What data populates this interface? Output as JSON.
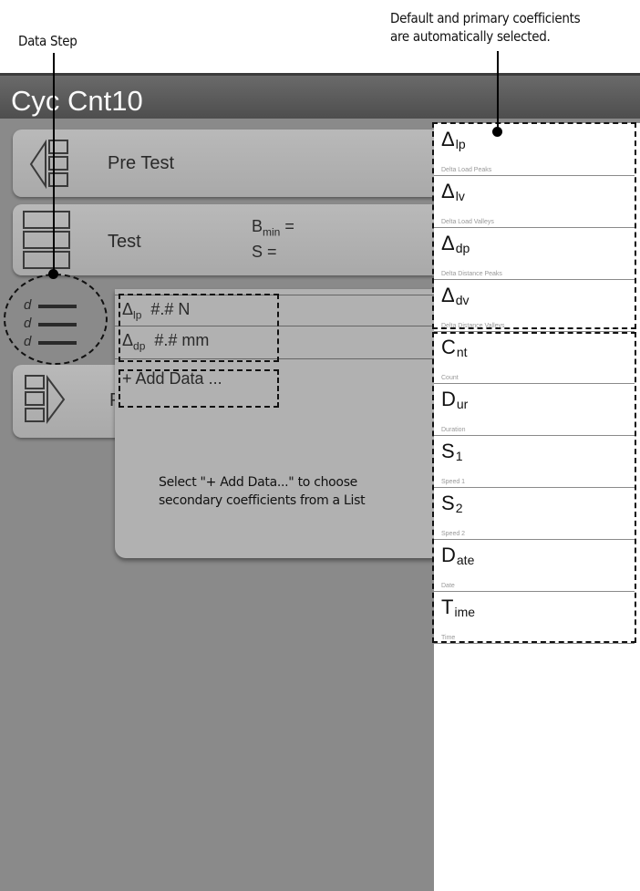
{
  "annotations": {
    "data_step": "Data Step",
    "default_primary_line1": "Default and primary coefficients",
    "default_primary_line2": "are automatically selected.",
    "add_data_hint_line1": "Select \"+ Add Data...\" to choose",
    "add_data_hint_line2": "secondary coefficients from a List"
  },
  "app": {
    "title": "Cyc Cnt10"
  },
  "steps": {
    "pre_test": {
      "label": "Pre Test"
    },
    "test": {
      "label": "Test",
      "bmin_label": "B",
      "bmin_sub": "min",
      "bmin_suffix": " =",
      "s_label": "S ="
    },
    "post_test": {
      "label": "P"
    }
  },
  "data_step": {
    "icon_letter": "d",
    "rows": [
      {
        "symbol": "Δ",
        "sub": "lp",
        "value": "#.# N"
      },
      {
        "symbol": "Δ",
        "sub": "dp",
        "value": "#.# mm"
      }
    ],
    "add_data_label": "+ Add Data ..."
  },
  "coefficients": [
    {
      "symbol": "Δ",
      "sub": "lp",
      "desc": "Delta Load Peaks",
      "group": "default"
    },
    {
      "symbol": "Δ",
      "sub": "lv",
      "desc": "Delta Load Valleys",
      "group": "default"
    },
    {
      "symbol": "Δ",
      "sub": "dp",
      "desc": "Delta Distance Peaks",
      "group": "default"
    },
    {
      "symbol": "Δ",
      "sub": "dv",
      "desc": "Delta Distance Valleys",
      "group": "default"
    },
    {
      "symbol": "C",
      "sub": "nt",
      "desc": "Count",
      "group": "primary"
    },
    {
      "symbol": "D",
      "sub": "ur",
      "desc": "Duration",
      "group": "primary"
    },
    {
      "symbol": "S",
      "sub": "1",
      "desc": "Speed 1",
      "group": "primary"
    },
    {
      "symbol": "S",
      "sub": "2",
      "desc": "Speed 2",
      "group": "primary"
    },
    {
      "symbol": "D",
      "sub": "ate",
      "desc": "Date",
      "group": "primary"
    },
    {
      "symbol": "T",
      "sub": "ime",
      "desc": "Time",
      "group": "primary"
    }
  ]
}
